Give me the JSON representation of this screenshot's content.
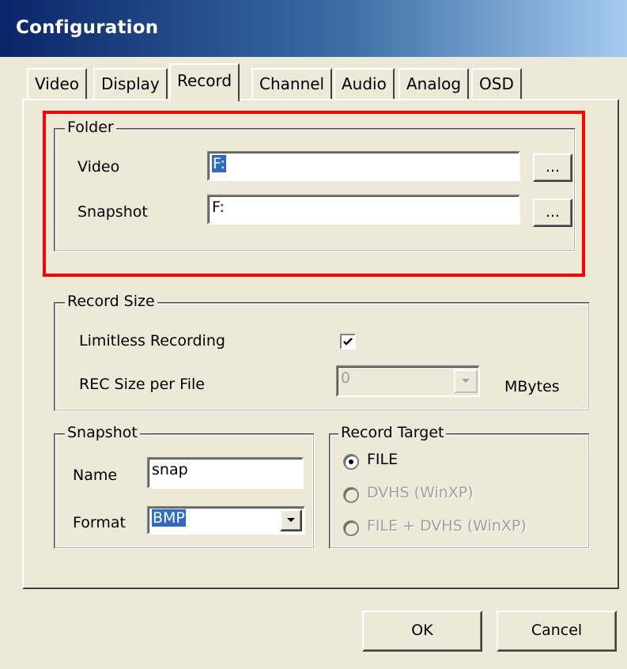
{
  "window": {
    "title": "Configuration"
  },
  "tabs": [
    {
      "label": "Video"
    },
    {
      "label": "Display"
    },
    {
      "label": "Record"
    },
    {
      "label": "Channel"
    },
    {
      "label": "Audio"
    },
    {
      "label": "Analog"
    },
    {
      "label": "OSD"
    }
  ],
  "active_tab": "Record",
  "folder": {
    "legend": "Folder",
    "video_label": "Video",
    "video_value": "F:",
    "snapshot_label": "Snapshot",
    "snapshot_value": "F:",
    "browse_label": "..."
  },
  "record_size": {
    "legend": "Record Size",
    "limitless_label": "Limitless Recording",
    "limitless_checked": true,
    "rec_size_label": "REC Size per File",
    "rec_size_value": "0",
    "unit": "MBytes"
  },
  "snapshot": {
    "legend": "Snapshot",
    "name_label": "Name",
    "name_value": "snap",
    "format_label": "Format",
    "format_value": "BMP"
  },
  "record_target": {
    "legend": "Record Target",
    "options": [
      {
        "label": "FILE",
        "selected": true,
        "enabled": true
      },
      {
        "label": "DVHS (WinXP)",
        "selected": false,
        "enabled": false
      },
      {
        "label": "FILE + DVHS (WinXP)",
        "selected": false,
        "enabled": false
      }
    ]
  },
  "buttons": {
    "ok": "OK",
    "cancel": "Cancel"
  },
  "colors": {
    "title_bar": "#0a246a",
    "highlight_box": "#ff0000",
    "selection": "#316ac5",
    "face": "#ece9d8"
  },
  "icons": {
    "checkbox_mark": "check-icon",
    "dropdown": "chevron-down-icon"
  }
}
